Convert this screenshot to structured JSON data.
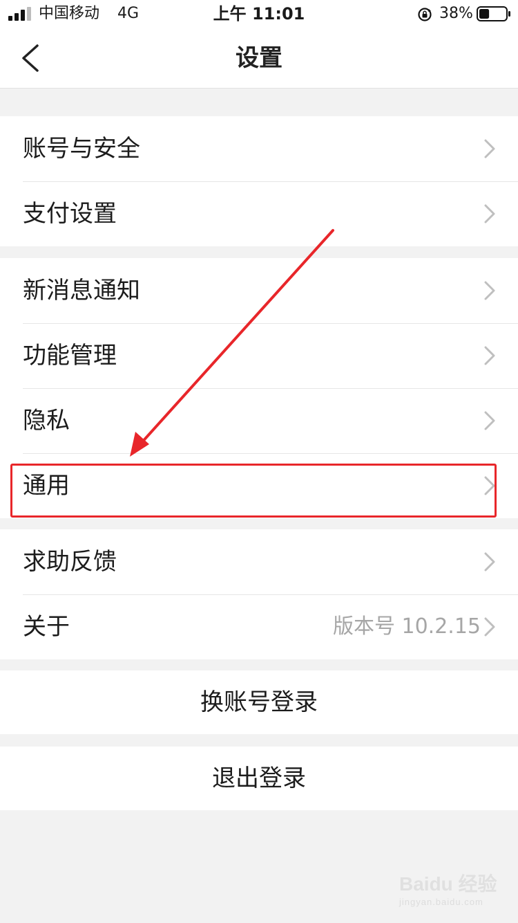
{
  "status_bar": {
    "carrier": "中国移动",
    "network": "4G",
    "time": "上午 11:01",
    "battery_percent": "38%",
    "battery_level": 0.38
  },
  "nav": {
    "title": "设置",
    "back_icon": "chevron-left-icon"
  },
  "groups": [
    {
      "items": [
        {
          "label": "账号与安全"
        },
        {
          "label": "支付设置"
        }
      ]
    },
    {
      "items": [
        {
          "label": "新消息通知"
        },
        {
          "label": "功能管理"
        },
        {
          "label": "隐私"
        },
        {
          "label": "通用",
          "highlighted": true
        }
      ]
    },
    {
      "items": [
        {
          "label": "求助反馈"
        },
        {
          "label": "关于",
          "value": "版本号 10.2.15"
        }
      ]
    }
  ],
  "actions": {
    "switch_account": "换账号登录",
    "logout": "退出登录"
  },
  "annotation": {
    "color": "#e8262a"
  },
  "watermark": {
    "main": "Baidu 经验",
    "sub": "jingyan.baidu.com"
  },
  "colors": {
    "background": "#f2f2f2",
    "surface": "#ffffff",
    "secondary_text": "#a6a6a6"
  }
}
